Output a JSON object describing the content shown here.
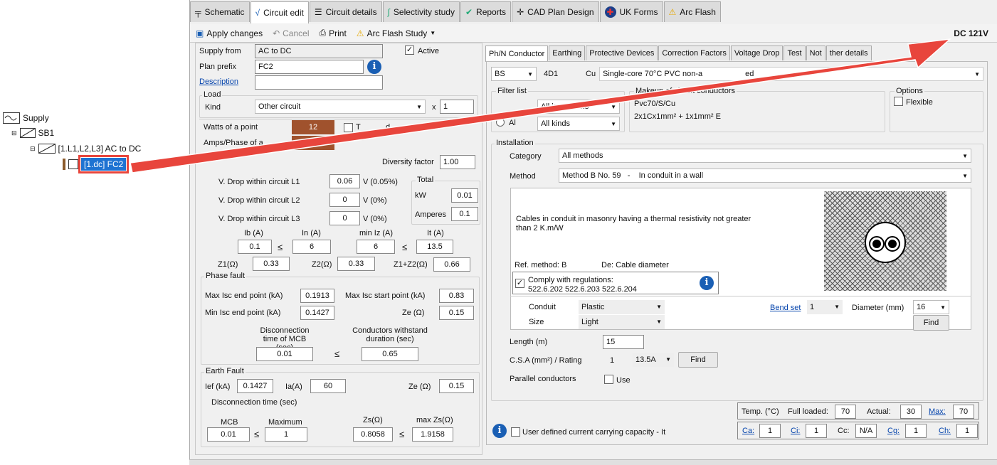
{
  "tree": {
    "supply": "Supply",
    "sb1": "SB1",
    "circuit": "[1.L1,L2,L3] AC to DC",
    "selected": "[1.dc] FC2"
  },
  "tabs": [
    {
      "label": "Schematic",
      "icon": "schematic-icon"
    },
    {
      "label": "Circuit edit",
      "icon": "circuit-edit-icon"
    },
    {
      "label": "Circuit details",
      "icon": "list-icon"
    },
    {
      "label": "Selectivity study",
      "icon": "selectivity-icon"
    },
    {
      "label": "Reports",
      "icon": "check-icon"
    },
    {
      "label": "CAD Plan Design",
      "icon": "crosshair-icon"
    },
    {
      "label": "UK Forms",
      "icon": "uk-flag-icon"
    },
    {
      "label": "Arc Flash",
      "icon": "warning-icon"
    }
  ],
  "toolbar": {
    "apply": "Apply changes",
    "cancel": "Cancel",
    "print": "Print",
    "arcflash": "Arc Flash Study"
  },
  "voltage": "DC 121V",
  "left": {
    "supply_from_label": "Supply from",
    "supply_from": "AC to DC",
    "active_label": "Active",
    "plan_prefix_label": "Plan prefix",
    "plan_prefix": "FC2",
    "description_label": "Description",
    "description": "",
    "load_label": "Load",
    "kind_label": "Kind",
    "kind": "Other circuit",
    "x_label": "x",
    "kind_count": "1",
    "watts_label": "Watts of a point",
    "watts": "12",
    "t_label": "T",
    "d_label": "d",
    "amps_label": "Amps/Phase of a",
    "amps": "0.1",
    "diversity_label": "Diversity factor",
    "diversity": "1.00",
    "vdrop_l1_label": "V. Drop within circuit L1",
    "vdrop_l1": "0.06",
    "vdrop_l1_pct": "V (0.05%)",
    "vdrop_l2_label": "V. Drop within circuit L2",
    "vdrop_l2": "0",
    "vdrop_l2_pct": "V (0%)",
    "vdrop_l3_label": "V. Drop within circuit L3",
    "vdrop_l3": "0",
    "vdrop_l3_pct": "V (0%)",
    "total_label": "Total",
    "kw_label": "kW",
    "kw": "0.01",
    "amperes_label": "Amperes",
    "amperes": "0.1",
    "ib_label": "Ib (A)",
    "ib": "0.1",
    "in_label": "In (A)",
    "in": "6",
    "miniz_label": "min Iz (A)",
    "miniz": "6",
    "it_label": "It (A)",
    "it": "13.5",
    "le": "≤",
    "z1_label": "Z1(Ω)",
    "z1": "0.33",
    "z2_label": "Z2(Ω)",
    "z2": "0.33",
    "z1z2_label": "Z1+Z2(Ω)",
    "z1z2": "0.66",
    "phase_fault_label": "Phase fault",
    "max_isc_end_label": "Max Isc end point (kA)",
    "max_isc_end": "0.1913",
    "max_isc_start_label": "Max Isc start point (kA)",
    "max_isc_start": "0.83",
    "min_isc_end_label": "Min Isc end point (kA)",
    "min_isc_end": "0.1427",
    "ze_label": "Ze (Ω)",
    "ze": "0.15",
    "disc_mcb_label": "Disconnection time of MCB (sec)",
    "disc_mcb": "0.01",
    "cond_withstand_label": "Conductors withstand duration (sec)",
    "cond_withstand": "0.65",
    "earth_fault_label": "Earth Fault",
    "ief_label": "Ief (kA)",
    "ief": "0.1427",
    "ia_label": "Ia(A)",
    "ia": "60",
    "ze2_label": "Ze (Ω)",
    "ze2": "0.15",
    "disc_time_label": "Disconnection time (sec)",
    "mcb_label": "MCB",
    "mcb": "0.01",
    "maximum_label": "Maximum",
    "maximum": "1",
    "zs_label": "Zs(Ω)",
    "zs": "0.8058",
    "maxzs_label": "max Zs(Ω)",
    "maxzs": "1.9158"
  },
  "right_tabs": [
    "Ph/N Conductor",
    "Earthing",
    "Protective Devices",
    "Correction Factors",
    "Voltage Drop",
    "Test",
    "Not",
    "ther details"
  ],
  "right": {
    "std": "BS",
    "code": "4D1",
    "material": "Cu",
    "cable_desc": "Single-core 70°C PVC non-a",
    "cable_desc_tail": "ed",
    "filter_label": "Filter list",
    "al_label": "Al",
    "insulations": "All insulations",
    "kinds": "All kinds",
    "makeup_label": "Makeup of circuit conductors",
    "makeup1": "Pvc70/S/Cu",
    "makeup2": "2x1Cx1mm² + 1x1mm² E",
    "options_label": "Options",
    "flexible_label": "Flexible",
    "installation_label": "Installation",
    "category_label": "Category",
    "category": "All methods",
    "method_label": "Method",
    "method": "Method B No. 59   -    In conduit in a wall",
    "method_desc": "Cables in conduit in masonry having a thermal resistivity not greater than 2 K.m/W",
    "ref_method": "Ref. method: B",
    "de_label": "De: Cable diameter",
    "comply_label": "Comply with regulations:",
    "comply_regs": "522.6.202 522.6.203 522.6.204",
    "conduit_label": "Conduit",
    "conduit": "Plastic",
    "size_label": "Size",
    "size": "Light",
    "bendset_label": "Bend set",
    "bendset": "1",
    "diameter_label": "Diameter (mm)",
    "diameter": "16",
    "find": "Find",
    "length_label": "Length (m)",
    "length": "15",
    "csa_label": "C.S.A (mm²) / Rating",
    "csa": "1",
    "rating": "13.5A",
    "parallel_label": "Parallel conductors",
    "use_label": "Use",
    "temp_label": "Temp. (°C)",
    "full_loaded_label": "Full loaded:",
    "full_loaded": "70",
    "actual_label": "Actual:",
    "actual": "30",
    "max_label": "Max:",
    "max": "70",
    "ca_label": "Ca:",
    "ca": "1",
    "ci_label": "Ci:",
    "ci": "1",
    "cc_label": "Cc:",
    "cc": "N/A",
    "cg_label": "Cg:",
    "cg": "1",
    "ch_label": "Ch:",
    "ch": "1",
    "user_ccc_label": "User defined current carrying capacity - It"
  },
  "colors": {
    "arrow": "#e8453c",
    "brown": "#a0522d",
    "selection": "#1e73d2",
    "info": "#1a5fb4"
  }
}
